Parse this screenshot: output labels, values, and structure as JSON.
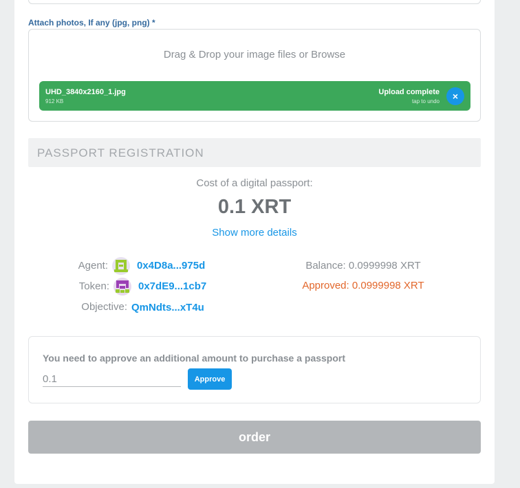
{
  "attach": {
    "label": "Attach photos, If any (jpg, png) *",
    "dropzone_text": "Drag & Drop your image files or Browse",
    "file": {
      "name": "UHD_3840x2160_1.jpg",
      "size": "912 KB",
      "status": "Upload complete",
      "undo": "tap to undo",
      "remove_icon": "×"
    }
  },
  "section": {
    "title": "PASSPORT REGISTRATION"
  },
  "cost": {
    "label": "Cost of a digital passport:",
    "value": "0.1 XRT",
    "details_link": "Show more details"
  },
  "info": {
    "agent_label": "Agent:",
    "agent_value": "0x4D8a...975d",
    "token_label": "Token:",
    "token_value": "0x7dE9...1cb7",
    "objective_label": "Objective:",
    "objective_value": "QmNdts...xT4u",
    "balance": "Balance: 0.0999998 XRT",
    "approved": "Approved: 0.0999998 XRT"
  },
  "approve": {
    "message": "You need to approve an additional amount to purchase a passport",
    "amount_value": "0.1",
    "button_label": "Approve"
  },
  "order": {
    "button_label": "order"
  },
  "colors": {
    "accent": "#1796e6",
    "success": "#3ca85a",
    "warning": "#e2662a",
    "disabled": "#b3b6b9"
  },
  "icons": {
    "agent_avatar": "identicon-avatar-green",
    "token_avatar": "identicon-avatar-purple"
  }
}
